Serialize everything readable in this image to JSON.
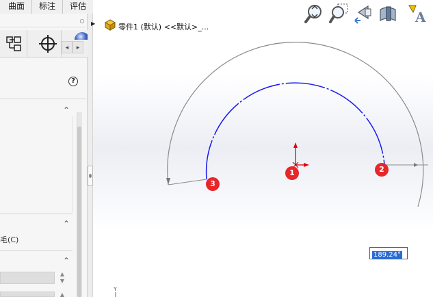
{
  "ribbon": {
    "tabs": [
      {
        "label": "曲面"
      },
      {
        "label": "标注"
      },
      {
        "label": "评估"
      }
    ]
  },
  "left_panel": {
    "nav_left": "◂",
    "nav_right": "▸",
    "help": "?",
    "collapse": "⌃",
    "option_label": "毛(C)",
    "spin_up": "▲",
    "spin_down": "▼"
  },
  "feature_tree": {
    "arrow": "▶",
    "part_name": "零件1 (默认) <<默认>_..."
  },
  "view_toolbar": {
    "icons": [
      "zoom-to-fit-icon",
      "zoom-to-area-icon",
      "previous-view-icon",
      "section-view-icon",
      "view-orientation-icon"
    ]
  },
  "sketch": {
    "markers": [
      "1",
      "2",
      "3"
    ],
    "angle_dimension": "189.24°",
    "triad_label": "Y",
    "colors": {
      "arc": "#1a1aee",
      "dimension": "#8a8a8a",
      "origin": "#e00000",
      "marker": "#e8262a",
      "dim_highlight": "#2a6bd4"
    }
  }
}
